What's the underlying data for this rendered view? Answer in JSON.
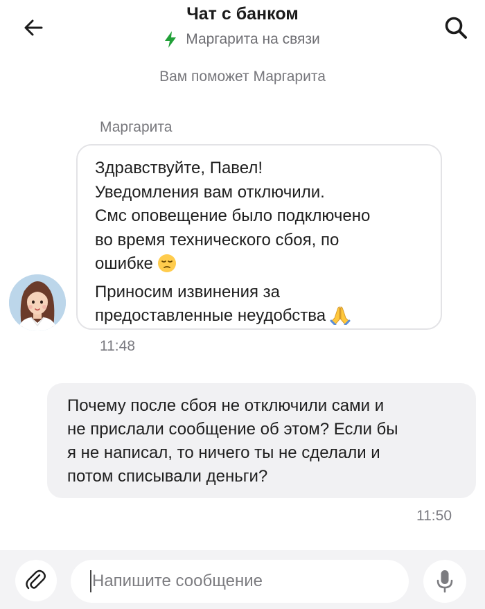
{
  "header": {
    "title": "Чат с банком",
    "status": "Маргарита на связи",
    "status_color": "#21a038",
    "back_icon": "arrow-left-icon",
    "search_icon": "search-icon"
  },
  "system_note": "Вам поможет Маргарита",
  "messages": [
    {
      "direction": "incoming",
      "sender": "Маргарита",
      "lines": [
        "Здравствуйте, Павел!",
        "Уведомления вам отключили.",
        "Смс оповещение было подключено",
        "во время технического сбоя, по",
        "ошибке",
        "Приносим извинения за",
        "предоставленные неудобства"
      ],
      "emojis": [
        "pensive-face-emoji",
        "folded-hands-emoji"
      ],
      "time": "11:48"
    },
    {
      "direction": "outgoing",
      "lines": [
        "Почему после сбоя не отключили сами и",
        "не прислали сообщение об этом? Если бы",
        "я не написал, то ничего ты не сделали и",
        "потом списывали деньги?"
      ],
      "time": "11:50"
    }
  ],
  "composer": {
    "placeholder": "Напишите сообщение",
    "attach_icon": "paperclip-icon",
    "mic_icon": "microphone-icon"
  }
}
